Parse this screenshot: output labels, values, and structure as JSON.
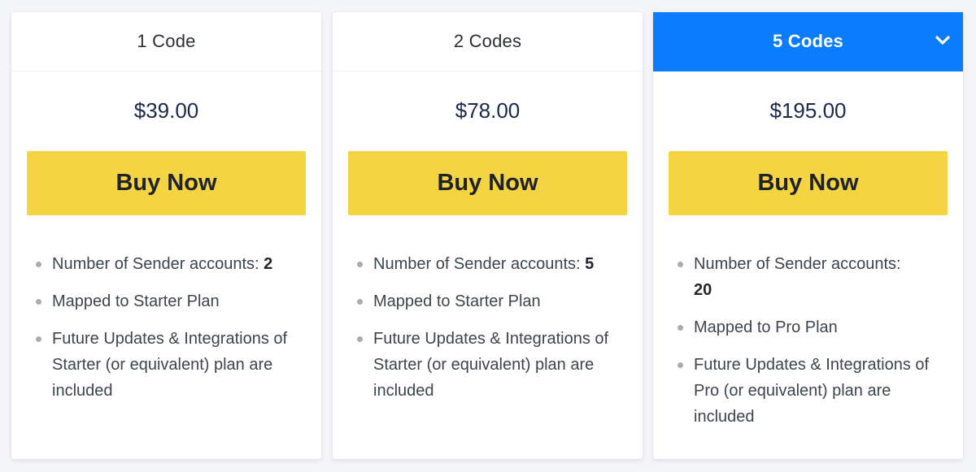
{
  "plans": [
    {
      "title": "1 Code",
      "price": "$39.00",
      "button_label": "Buy Now",
      "active": false,
      "features": [
        {
          "text": "Number of Sender accounts: ",
          "bold": "2"
        },
        {
          "text": "Mapped to Starter Plan",
          "bold": ""
        },
        {
          "text": "Future Updates & Integrations of Starter (or equivalent) plan are included",
          "bold": ""
        }
      ]
    },
    {
      "title": "2 Codes",
      "price": "$78.00",
      "button_label": "Buy Now",
      "active": false,
      "features": [
        {
          "text": "Number of Sender accounts: ",
          "bold": "5"
        },
        {
          "text": "Mapped to Starter Plan",
          "bold": ""
        },
        {
          "text": "Future Updates & Integrations of Starter (or equivalent) plan are included",
          "bold": ""
        }
      ]
    },
    {
      "title": "5 Codes",
      "price": "$195.00",
      "button_label": "Buy Now",
      "active": true,
      "header_icon": "chevron-down-icon",
      "features": [
        {
          "text": "Number of Sender accounts: ",
          "bold": "20"
        },
        {
          "text": "Mapped to Pro Plan",
          "bold": ""
        },
        {
          "text": "Future Updates & Integrations of Pro (or equivalent) plan are included",
          "bold": ""
        }
      ]
    }
  ],
  "colors": {
    "accent_blue": "#0a7cff",
    "button_yellow": "#f5d443",
    "price_navy": "#1b2a4a"
  }
}
